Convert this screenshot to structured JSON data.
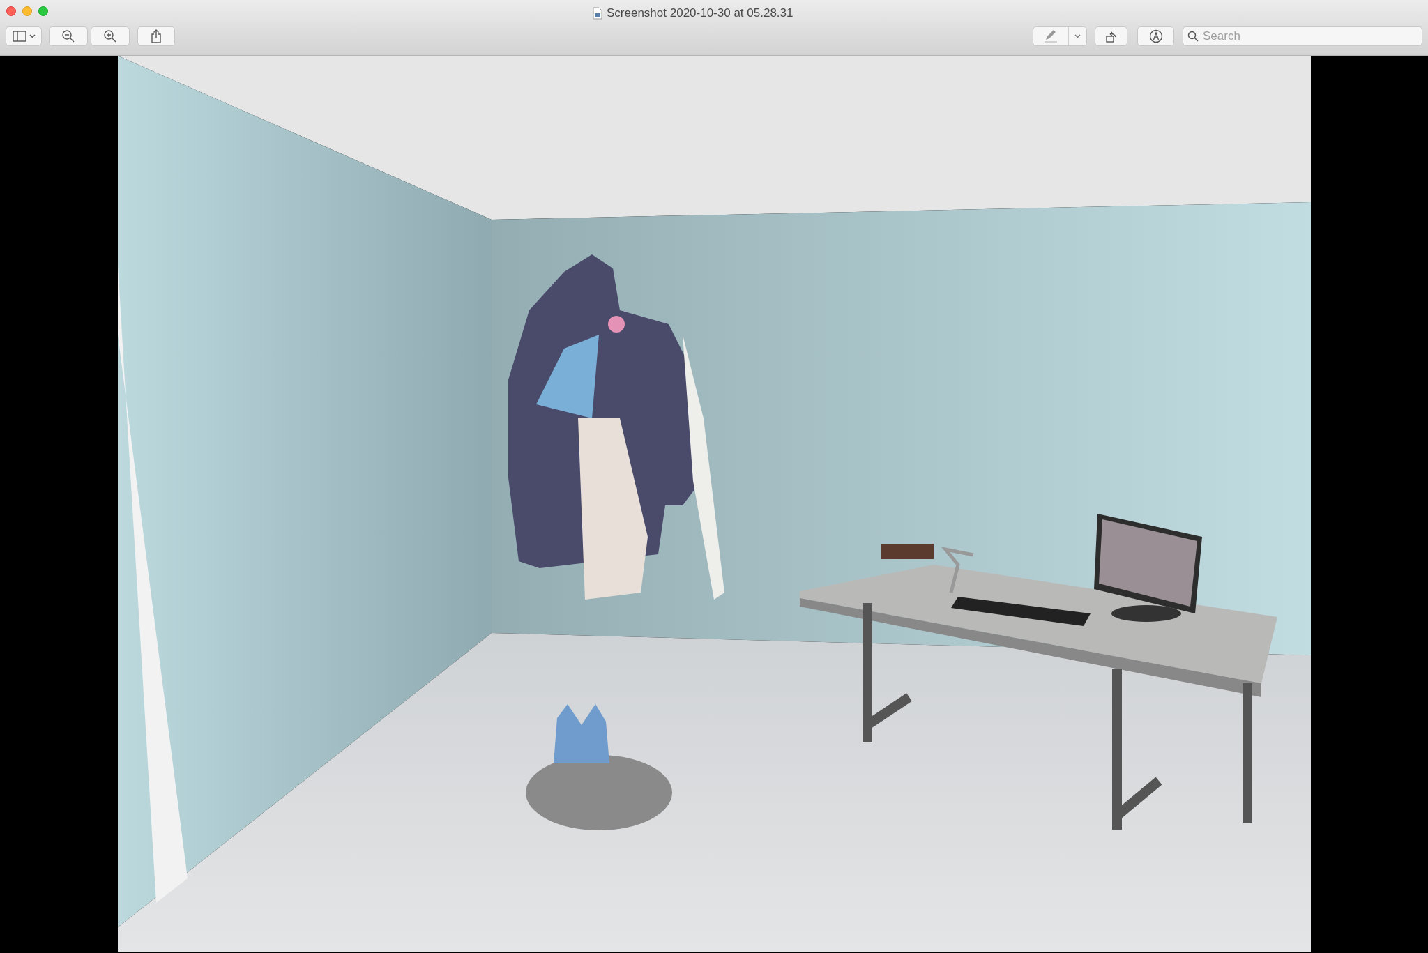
{
  "window": {
    "title": "Screenshot 2020-10-30 at 05.28.31"
  },
  "toolbar": {
    "search": {
      "placeholder": "Search"
    }
  }
}
